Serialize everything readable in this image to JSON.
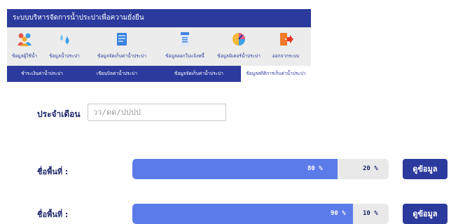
{
  "app": {
    "title": "ระบบบริหารจัดการน้ำประปาเพื่อความยั่งยืน"
  },
  "iconbar": {
    "items": [
      {
        "label": "ข้อมูลผู้ใช้น้ำ",
        "icon": "users-icon",
        "color": "#e8574a"
      },
      {
        "label": "ข้อมูลน้ำประปา",
        "icon": "water-drops-icon",
        "color": "#3aa0e8"
      },
      {
        "label": "ข้อมูลจัดเก็บค่าน้ำประปา",
        "icon": "document-icon",
        "color": "#3a82e0"
      },
      {
        "label": "ข้อมูลออกใบแจ้งหนี้",
        "icon": "invoice-icon",
        "color": "#3a82e0"
      },
      {
        "label": "ข้อมูลมิเตอร์น้ำประปา",
        "icon": "gauge-icon",
        "color": "#e85a8c"
      },
      {
        "label": "ออกจากระบบ",
        "icon": "logout-door-icon",
        "color": "#f07a2a"
      }
    ]
  },
  "subnav": {
    "tabs": [
      {
        "label": "ชำระเงินค่าน้ำประปา"
      },
      {
        "label": "เขียนบิลค่าน้ำประปา"
      },
      {
        "label": "ข้อมูลจัดเก็บค่าน้ำประปา"
      },
      {
        "label": "ข้อมูลสถิติการเก็บค่าน้ำประปา"
      }
    ]
  },
  "filter": {
    "label": "ประจำเดือน",
    "placeholder": "วว/ดด/ปปปป"
  },
  "areas": [
    {
      "label": "ชื่อพื้นที่ :",
      "collected_percent": 80,
      "collected_text": "80 %",
      "remaining_text": "20 %",
      "button_label": "ดูข้อมูล"
    },
    {
      "label": "ชื่อพื้นที่ :",
      "collected_percent": 90,
      "collected_text": "90 %",
      "remaining_text": "10 %",
      "button_label": "ดูข้อมูล"
    }
  ]
}
